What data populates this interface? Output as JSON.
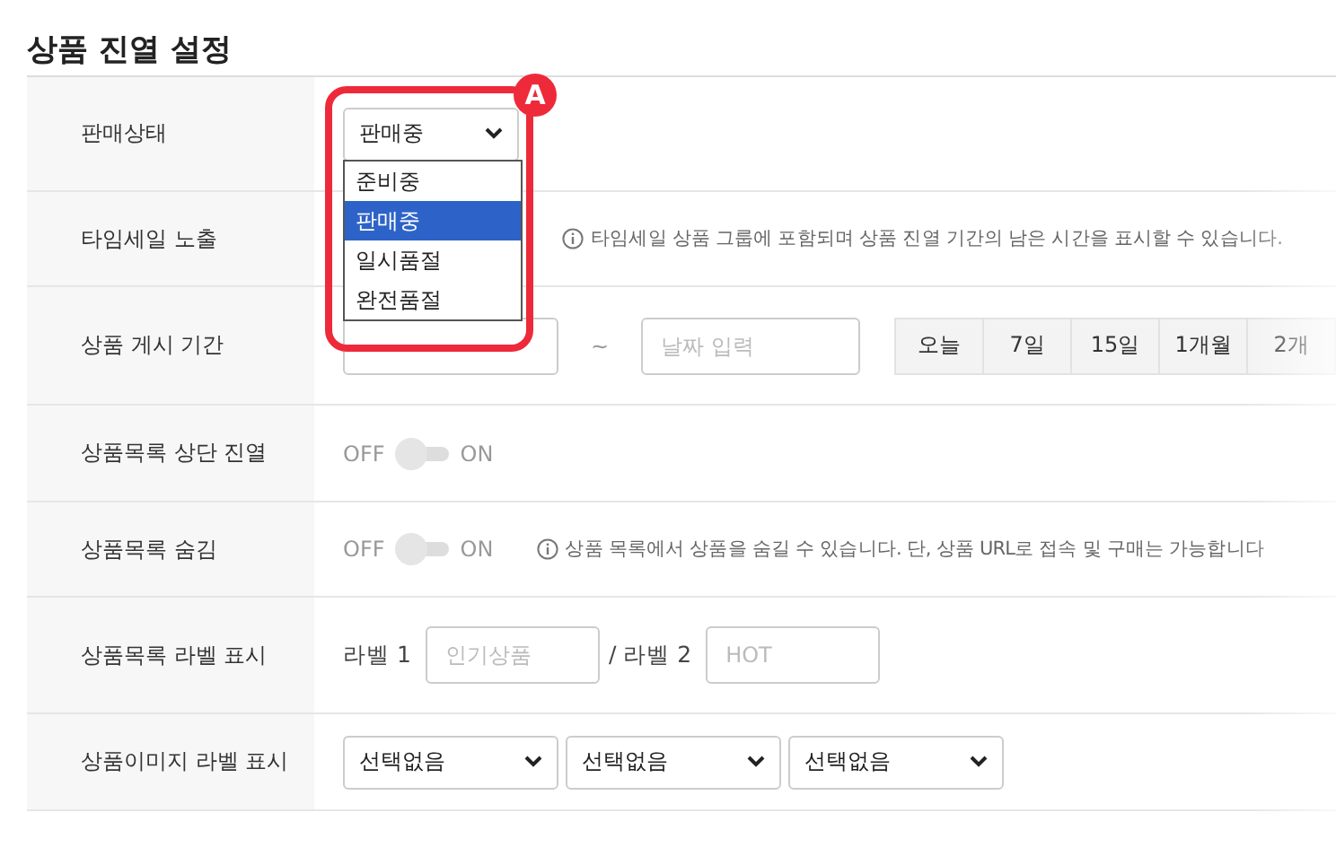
{
  "title": "상품 진열 설정",
  "rows": [
    {
      "label": "판매상태",
      "kind": "status",
      "select": {
        "value": "판매중",
        "options": [
          {
            "label": "준비중",
            "selected": false
          },
          {
            "label": "판매중",
            "selected": true
          },
          {
            "label": "일시품절",
            "selected": false
          },
          {
            "label": "완전품절",
            "selected": false
          }
        ]
      },
      "callout": "A"
    },
    {
      "label": "타임세일 노출",
      "kind": "note",
      "note": "타임세일 상품 그룹에 포함되며 상품 진열 기간의 남은 시간을 표시할 수 있습니다."
    },
    {
      "label": "상품 게시 기간",
      "kind": "period",
      "separator": "~",
      "end_placeholder": "날짜 입력",
      "presets": [
        "오늘",
        "7일",
        "15일",
        "1개월",
        "2개"
      ]
    },
    {
      "label": "상품목록 상단 진열",
      "kind": "toggle",
      "off_label": "OFF",
      "on_label": "ON",
      "on": false
    },
    {
      "label": "상품목록 숨김",
      "kind": "toggle",
      "off_label": "OFF",
      "on_label": "ON",
      "on": false,
      "note": "상품 목록에서 상품을 숨길 수 있습니다. 단, 상품 URL로 접속 및 구매는 가능합니다"
    },
    {
      "label": "상품목록 라벨 표시",
      "kind": "labels",
      "fields": [
        {
          "prefix": "라벨 1",
          "placeholder": "인기상품"
        },
        {
          "prefix": "/ 라벨 2",
          "placeholder": "HOT"
        }
      ]
    },
    {
      "label": "상품이미지 라벨 표시",
      "kind": "selects",
      "selects": [
        "선택없음",
        "선택없음",
        "선택없음"
      ]
    }
  ]
}
